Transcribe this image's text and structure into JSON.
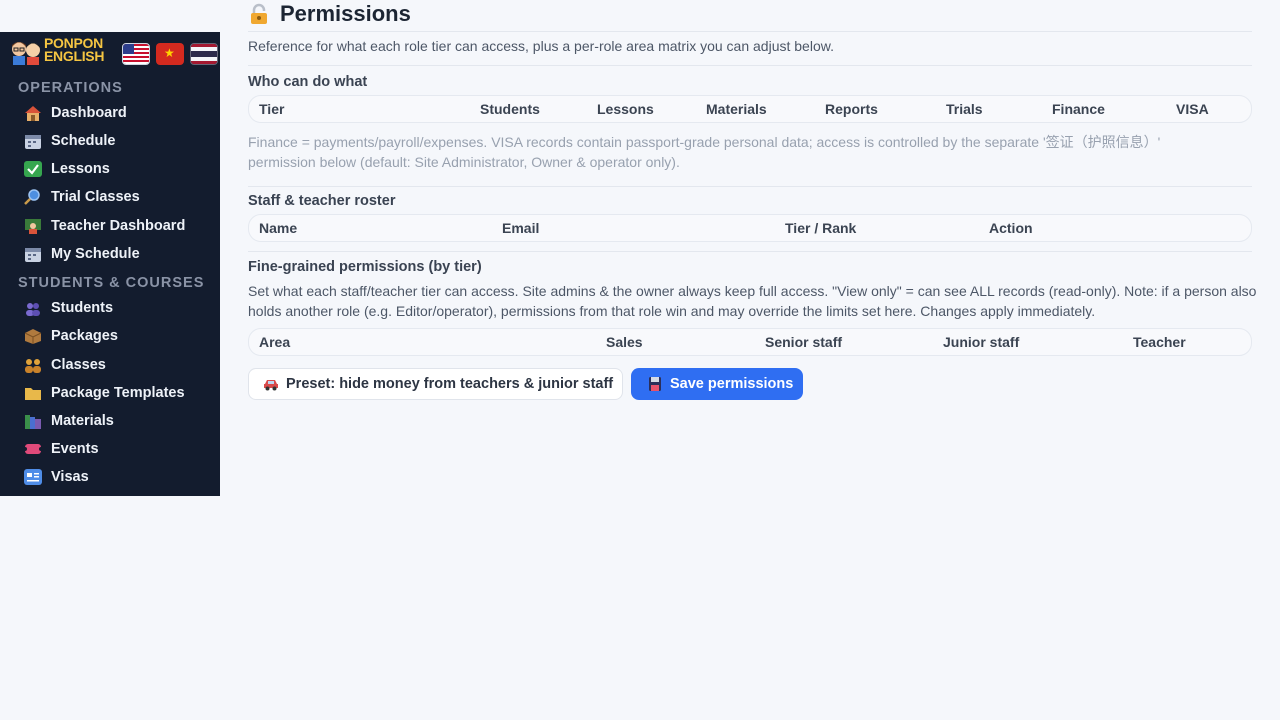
{
  "brand": {
    "logo_line1": "PONPON",
    "logo_line2": "ENGLISH"
  },
  "sidebar": {
    "sections": [
      {
        "label": "OPERATIONS"
      },
      {
        "label": "STUDENTS & COURSES"
      }
    ],
    "items": [
      {
        "label": "Dashboard",
        "icon": "house-icon"
      },
      {
        "label": "Schedule",
        "icon": "calendar-icon"
      },
      {
        "label": "Lessons",
        "icon": "checkmark-icon"
      },
      {
        "label": "Trial Classes",
        "icon": "magnifier-icon"
      },
      {
        "label": "Teacher Dashboard",
        "icon": "teacher-icon"
      },
      {
        "label": "My Schedule",
        "icon": "calendar-icon"
      },
      {
        "label": "Students",
        "icon": "people-icon"
      },
      {
        "label": "Packages",
        "icon": "package-icon"
      },
      {
        "label": "Classes",
        "icon": "group-icon"
      },
      {
        "label": "Package Templates",
        "icon": "folder-icon"
      },
      {
        "label": "Materials",
        "icon": "books-icon"
      },
      {
        "label": "Events",
        "icon": "ticket-icon"
      },
      {
        "label": "Visas",
        "icon": "passport-icon"
      }
    ]
  },
  "page": {
    "title": "Permissions",
    "intro": "Reference for what each role tier can access, plus a per-role area matrix you can adjust below."
  },
  "who_can": {
    "heading": "Who can do what",
    "columns": [
      "Tier",
      "Students",
      "Lessons",
      "Materials",
      "Reports",
      "Trials",
      "Finance",
      "VISA"
    ],
    "note": "Finance = payments/payroll/expenses. VISA records contain passport-grade personal data; access is controlled by the separate '签证（护照信息）' permission below (default: Site Administrator, Owner & operator only)."
  },
  "roster": {
    "heading": "Staff & teacher roster",
    "columns": [
      "Name",
      "Email",
      "Tier / Rank",
      "Action"
    ]
  },
  "fine": {
    "heading": "Fine-grained permissions (by tier)",
    "description": "Set what each staff/teacher tier can access. Site admins & the owner always keep full access. \"View only\" = can see ALL records (read-only). Note: if a person also holds another role (e.g. Editor/operator), permissions from that role win and may override the limits set here. Changes apply immediately.",
    "columns": [
      "Area",
      "Sales",
      "Senior staff",
      "Junior staff",
      "Teacher"
    ]
  },
  "actions": {
    "preset_label": "Preset: hide money from teachers & junior staff",
    "save_label": "Save permissions"
  },
  "colors": {
    "sidebar_bg": "#131c2e",
    "primary": "#2f6ef2",
    "page_bg": "#f5f7fb"
  }
}
